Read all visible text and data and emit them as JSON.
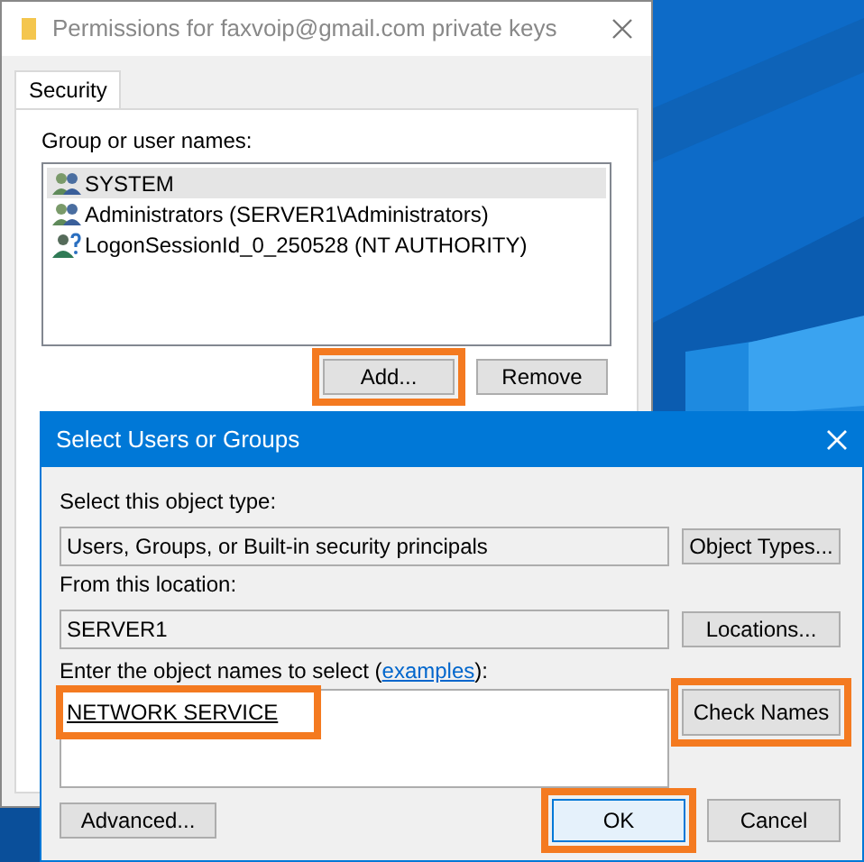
{
  "back_window": {
    "title": "Permissions for faxvoip@gmail.com private keys",
    "tabs": [
      {
        "label": "Security",
        "selected": true
      }
    ],
    "list_label": "Group or user names:",
    "users": [
      {
        "name": "SYSTEM",
        "kind": "group",
        "selected": true
      },
      {
        "name": "Administrators (SERVER1\\Administrators)",
        "kind": "group",
        "selected": false
      },
      {
        "name": "LogonSessionId_0_250528 (NT AUTHORITY)",
        "kind": "unknown",
        "selected": false
      }
    ],
    "buttons": [
      {
        "label": "Add...",
        "highlighted": true
      },
      {
        "label": "Remove",
        "highlighted": false
      }
    ]
  },
  "dialog": {
    "title": "Select Users or Groups",
    "object_type_label": "Select this object type:",
    "object_type_value": "Users, Groups, or Built-in security principals",
    "object_types_button": {
      "label": "Object Types...",
      "highlighted": false
    },
    "location_label": "From this location:",
    "location_value": "SERVER1",
    "locations_button": {
      "label": "Locations...",
      "highlighted": false
    },
    "names_label_before": "Enter the object names to select (",
    "names_link": "examples",
    "names_label_after": "):",
    "names_value": {
      "text": "NETWORK SERVICE",
      "highlighted": true
    },
    "check_names_button": {
      "label": "Check Names",
      "highlighted": true
    },
    "buttons": [
      {
        "label": "Advanced...",
        "kind": "left",
        "highlighted": false
      },
      {
        "label": "OK",
        "kind": "default",
        "highlighted": true
      },
      {
        "label": "Cancel",
        "kind": "normal",
        "highlighted": false
      }
    ]
  }
}
